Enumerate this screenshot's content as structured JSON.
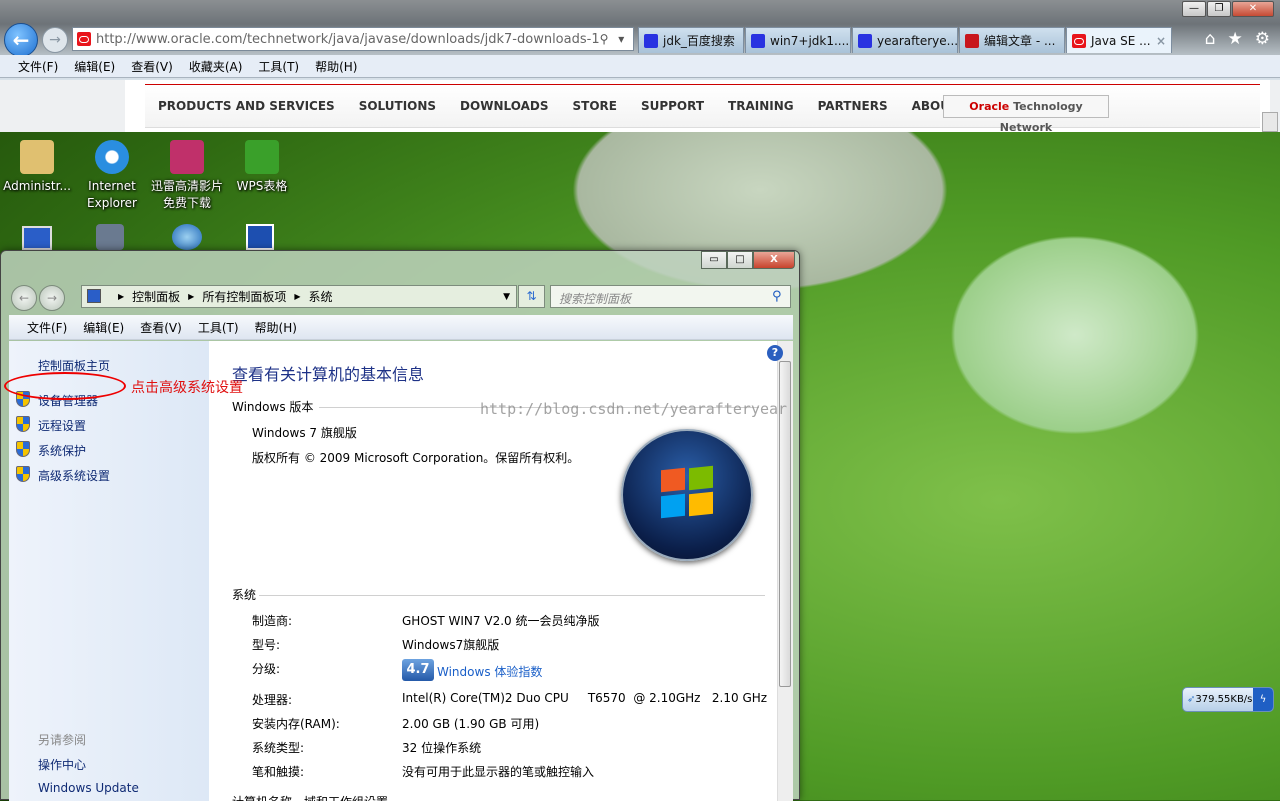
{
  "browser": {
    "url": "http://www.oracle.com/technetwork/java/javase/downloads/jdk7-downloads-1",
    "address_tools": "⚲ ▾ ▣ ↻ ✕",
    "tabs": [
      {
        "label": "jdk_百度搜索",
        "icon": "baidu-icon"
      },
      {
        "label": "win7+jdk1....",
        "icon": "baidu-icon"
      },
      {
        "label": "yearafterye...",
        "icon": "baidu-icon"
      },
      {
        "label": "编辑文章 - ...",
        "icon": "csdn-icon"
      },
      {
        "label": "Java SE ...",
        "icon": "oracle-icon",
        "active": true
      }
    ],
    "close_tab": "×",
    "window_controls": {
      "minimize": "—",
      "maximize": "❐",
      "close": "✕"
    },
    "nav_icons": {
      "home": "⌂",
      "favorites": "★",
      "tools": "⚙"
    },
    "menu": [
      "文件(F)",
      "编辑(E)",
      "查看(V)",
      "收藏夹(A)",
      "工具(T)",
      "帮助(H)"
    ]
  },
  "oracle_page": {
    "nav": [
      "PRODUCTS AND SERVICES",
      "SOLUTIONS",
      "DOWNLOADS",
      "STORE",
      "SUPPORT",
      "TRAINING",
      "PARTNERS",
      "ABOUT"
    ],
    "otn_brand": "Oracle",
    "otn_rest": " Technology Network"
  },
  "desktop": {
    "icons": [
      {
        "label": "Administr...",
        "color": "#e0c070"
      },
      {
        "label": "Internet Explorer",
        "color": "#2a8ee0"
      },
      {
        "label": "迅雷高清影片免费下载",
        "color": "#c0306a"
      },
      {
        "label": "WPS表格",
        "color": "#3aa02a"
      }
    ],
    "watermark": "http://blog.csdn.net/yearafteryear",
    "speed": "379.55KB/s"
  },
  "control_panel": {
    "breadcrumb": [
      "控制面板",
      "所有控制面板项",
      "系统"
    ],
    "search_placeholder": "搜索控制面板",
    "menu": [
      "文件(F)",
      "编辑(E)",
      "查看(V)",
      "工具(T)",
      "帮助(H)"
    ],
    "left": {
      "home": "控制面板主页",
      "links": [
        "设备管理器",
        "远程设置",
        "系统保护",
        "高级系统设置"
      ],
      "see_also": "另请参阅",
      "see_also_links": [
        "操作中心",
        "Windows Update"
      ]
    },
    "annotation": "点击高级系统设置",
    "title": "查看有关计算机的基本信息",
    "edition_section": "Windows 版本",
    "edition": "Windows 7 旗舰版",
    "copyright": "版权所有 © 2009 Microsoft Corporation。保留所有权利。",
    "system_section": "系统",
    "rows": [
      {
        "label": "制造商:",
        "value": "GHOST WIN7 V2.0 统一会员纯净版"
      },
      {
        "label": "型号:",
        "value": "Windows7旗舰版"
      },
      {
        "label": "分级:",
        "value": "Windows 体验指数"
      },
      {
        "label": "处理器:",
        "value": "Intel(R) Core(TM)2 Duo CPU     T6570  @ 2.10GHz   2.10 GHz"
      },
      {
        "label": "安装内存(RAM):",
        "value": "2.00 GB (1.90 GB 可用)"
      },
      {
        "label": "系统类型:",
        "value": "32 位操作系统"
      },
      {
        "label": "笔和触摸:",
        "value": "没有可用于此显示器的笔或触控输入"
      }
    ],
    "wei_score": "4.7",
    "next_section": "计算机名称、域和工作组设置"
  }
}
